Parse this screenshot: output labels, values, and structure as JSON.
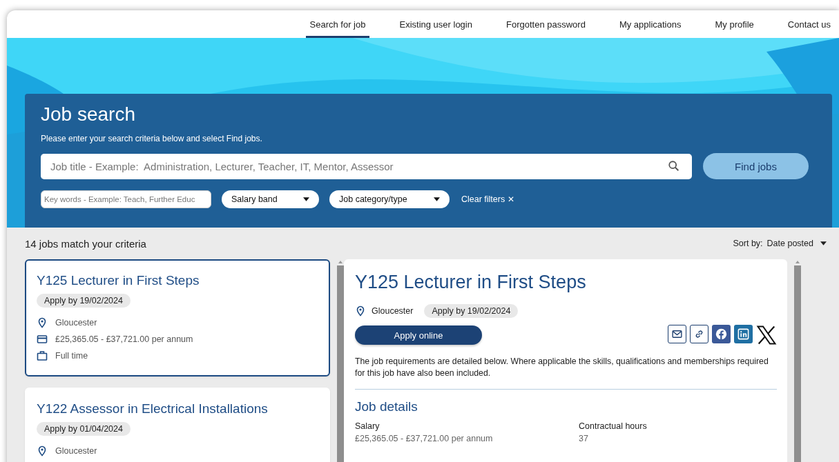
{
  "nav": [
    {
      "label": "Search for job",
      "selected": true
    },
    {
      "label": "Existing user login",
      "selected": false
    },
    {
      "label": "Forgotten password",
      "selected": false
    },
    {
      "label": "My applications",
      "selected": false
    },
    {
      "label": "My profile",
      "selected": false
    },
    {
      "label": "Contact us",
      "selected": false
    }
  ],
  "search": {
    "title": "Job search",
    "intro": "Please enter your search criteria below and select Find jobs.",
    "job_title_placeholder": "Job title - Example:  Administration, Lecturer, Teacher, IT, Mentor, Assessor",
    "find_button": "Find jobs",
    "keywords_placeholder": "Key words - Example: Teach, Further Educ",
    "filters": [
      "Salary band",
      "Job category/type"
    ],
    "clear": "Clear filters",
    "clear_icon": "✕"
  },
  "results": {
    "count": "14 jobs match your criteria",
    "sort_label": "Sort by:",
    "sort_value": "Date posted"
  },
  "jobs": [
    {
      "title": "Y125 Lecturer in First Steps",
      "apply_by": "Apply by 19/02/2024",
      "selected": true,
      "details": [
        {
          "kind": "location",
          "text": "Gloucester"
        },
        {
          "kind": "salary",
          "text": "£25,365.05 - £37,721.00 per annum"
        },
        {
          "kind": "hours",
          "text": "Full time"
        }
      ]
    },
    {
      "title": "Y122 Assessor in Electrical Installations",
      "apply_by": "Apply by 01/04/2024",
      "selected": false,
      "details": [
        {
          "kind": "location",
          "text": "Gloucester"
        }
      ]
    }
  ],
  "detail": {
    "title": "Y125 Lecturer in First Steps",
    "location": "Gloucester",
    "apply_by": "Apply by 19/02/2024",
    "apply_button": "Apply online",
    "share": [
      {
        "kind": "email"
      },
      {
        "kind": "link"
      },
      {
        "kind": "facebook"
      },
      {
        "kind": "linkedin"
      },
      {
        "kind": "x"
      }
    ],
    "intro": "The job requirements are detailed below. Where applicable the skills, qualifications and memberships required for this job have also been included.",
    "section": "Job details",
    "fields": [
      {
        "label": "Salary",
        "value": "£25,365.05 - £37,721.00 per annum"
      },
      {
        "label": "Contractual hours",
        "value": "37"
      }
    ]
  }
}
